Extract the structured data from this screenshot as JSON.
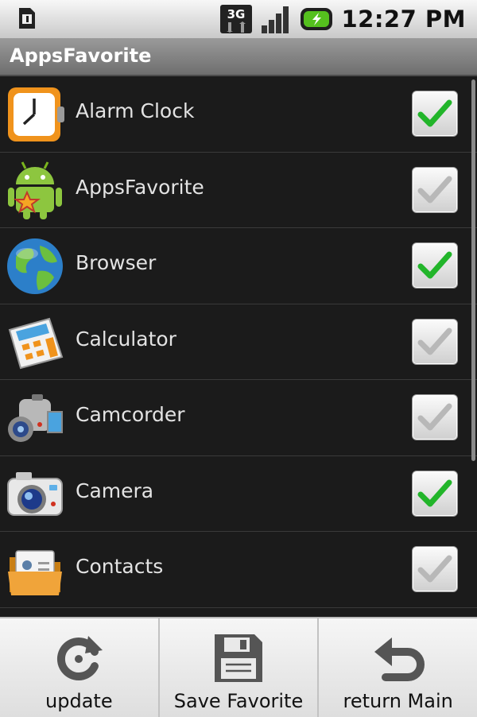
{
  "status_bar": {
    "time": "12:27 PM",
    "network": "3G"
  },
  "app_title": "AppsFavorite",
  "apps": [
    {
      "label": "Alarm Clock",
      "icon": "alarm-clock-icon",
      "checked": true
    },
    {
      "label": "AppsFavorite",
      "icon": "android-robot-icon",
      "checked": false
    },
    {
      "label": "Browser",
      "icon": "globe-icon",
      "checked": true
    },
    {
      "label": "Calculator",
      "icon": "calculator-icon",
      "checked": false
    },
    {
      "label": "Camcorder",
      "icon": "camcorder-icon",
      "checked": false
    },
    {
      "label": "Camera",
      "icon": "camera-icon",
      "checked": true
    },
    {
      "label": "Contacts",
      "icon": "contacts-folder-icon",
      "checked": false
    }
  ],
  "menu": [
    {
      "label": "update",
      "icon": "refresh-icon"
    },
    {
      "label": "Save Favorite",
      "icon": "floppy-disk-icon"
    },
    {
      "label": "return Main",
      "icon": "return-arrow-icon"
    }
  ],
  "colors": {
    "check_green": "#22b52a",
    "check_gray": "#b8b8b8"
  }
}
